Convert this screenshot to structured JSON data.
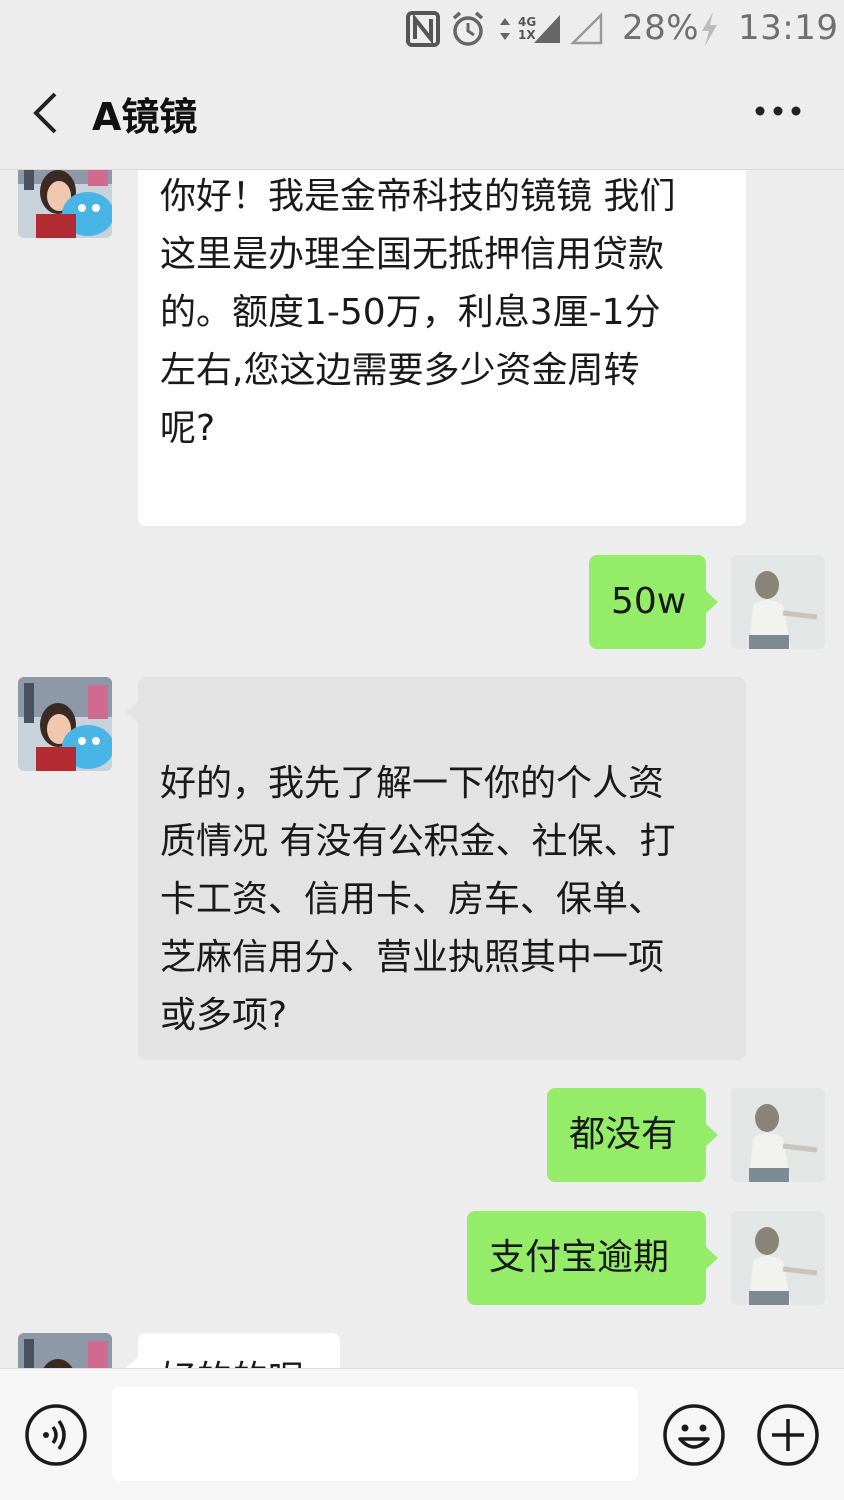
{
  "status_bar": {
    "battery": "28%",
    "time": "13:19",
    "network_top": "4G",
    "network_bottom": "1X",
    "icons": [
      "nfc-icon",
      "alarm-icon",
      "data-arrows-icon",
      "signal-icon",
      "signal-empty-icon",
      "charging-icon"
    ]
  },
  "header": {
    "title": "A镜镜",
    "icons": [
      "back-arrow-icon",
      "more-dots-icon"
    ]
  },
  "messages": [
    {
      "from": "contact",
      "text": "你好！我是金帝科技的镜镜 我们\n这里是办理全国无抵押信用贷款\n的。额度1-50万，利息3厘-1分\n左右,您这边需要多少资金周转\n呢?"
    },
    {
      "from": "me",
      "text": "50w"
    },
    {
      "from": "contact",
      "text": "好的，我先了解一下你的个人资\n质情况 有没有公积金、社保、打\n卡工资、信用卡、房车、保单、\n芝麻信用分、营业执照其中一项\n或多项?"
    },
    {
      "from": "me",
      "text": "都没有"
    },
    {
      "from": "me",
      "text": "支付宝逾期"
    },
    {
      "from": "contact",
      "text": "好的的呢"
    }
  ],
  "input_bar": {
    "icons": [
      "voice-icon",
      "emoji-icon",
      "plus-icon"
    ],
    "placeholder": ""
  },
  "colors": {
    "background": "#ededed",
    "outgoing_bubble": "#95ec69",
    "incoming_bubble": "#ffffff",
    "text": "#191919"
  }
}
